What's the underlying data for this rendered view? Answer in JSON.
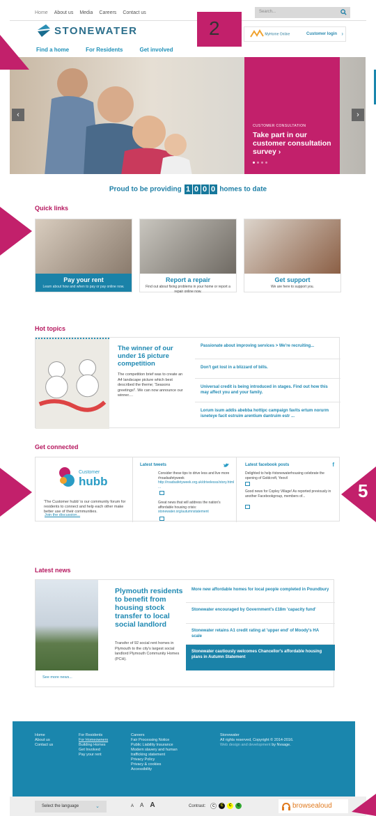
{
  "topnav": [
    "Home",
    "About us",
    "Media",
    "Careers",
    "Contact us"
  ],
  "search_placeholder": "Search...",
  "logo_text": "STONEWATER",
  "myhome_label": "MyHome Online",
  "customer_login": "Customer login",
  "mainnav": [
    "Find a home",
    "For Residents",
    "Get involved"
  ],
  "hero": {
    "kicker": "CUSTOMER CONSULTATION",
    "title": "Take part in our customer consultation survey  ›"
  },
  "proud": {
    "before": "Proud to be providing",
    "digits": [
      "1",
      "0",
      "0",
      "0"
    ],
    "after": "homes to date"
  },
  "quick_links": {
    "heading": "Quick links",
    "items": [
      {
        "title": "Pay your rent",
        "sub": "Learn about how and when to pay or pay online now."
      },
      {
        "title": "Report a repair",
        "sub": "Find out about fixing problems in your home or report a repair online now."
      },
      {
        "title": "Get support",
        "sub": "We are here to support you."
      }
    ]
  },
  "hot_topics": {
    "heading": "Hot topics",
    "feature_title": "The winner of our under 16 picture competition",
    "feature_body": "The competition brief was to create an A4 landscape picture which best described the theme; 'Seasons greetings!'. We can now announce our winner....",
    "items": [
      "Passionate about improving services > We're recruiting...",
      "Don't get lost in a blizzard of bills.",
      "Universal credit is being introduced in stages. Find out how this may affect you and your family.",
      "Lorum isum addis abebba hottipc campaign favits ertum norurm isneteye facit estruim arentium dantruim estr ..."
    ]
  },
  "get_connected": {
    "heading": "Get connected",
    "hubb_small": "Customer",
    "hubb_big": "hubb",
    "hubb_desc": "'The Customer hubb' is our community forum for residents to connect and help each other make better use of their communities.",
    "hubb_link": "Join the discussion...",
    "tweets_heading": "Latest tweets",
    "tweet1": "Consider these tips to drive less and live more #roadsafetyweek",
    "tweet1_link": "http://roadsafetyweek.org.uk/drivelesss/story.html ...",
    "tweet2": "Great news that will address the nation's affordable housing crisis:",
    "tweet2_link": "stonewater.org/autumnstatement",
    "fb_heading": "Latest facebook posts",
    "fb1": "Delighted to help #stonewaterhousing celebrate the opening of Goldcroft, Yeovil",
    "fb2": "Good news for Copley Village! As reported previously in another Facebookgroup, members of..."
  },
  "latest_news": {
    "heading": "Latest news",
    "feature_title": "Plymouth residents to benefit from housing stock transfer to local social landlord",
    "feature_body": "Transfer of 92 social rent homes in Plymouth to the city's largest social landlord Plymouth Community Homes (PCH).",
    "items": [
      "More new affordable homes for local people completed in Poundbury",
      "Stonewater encouraged by Government's £18m 'capacity fund'",
      "Stonewater retains A1 credit rating at 'upper end' of Moody's HA scale",
      "Stonewater cautiously welcomes Chancellor's affordable housing plans in Autumn Statement"
    ],
    "more": "See more news..."
  },
  "footer": {
    "col1": [
      "Home",
      "About us",
      "Contact us"
    ],
    "col2": [
      "For Residents",
      "For Homeowners",
      "Building Homes",
      "Get Involved",
      "Pay your rent"
    ],
    "col3": [
      "Careers",
      "Fair Processing Notice",
      "Public Liability Insurance",
      "Modern slavery and human",
      "trafficking statement",
      "Privacy Policy",
      "Privacy & cookies",
      "Accessibility"
    ],
    "company": "Stonewater",
    "rights": "All rights reserved, Copyright © 2014-2016.",
    "credit_pre": "Web design and development",
    "credit_by": "by Nvsage."
  },
  "bottombar": {
    "language": "Select the language",
    "text_sizes": [
      "A",
      "A",
      "A"
    ],
    "contrast_label": "Contrast:",
    "contrast_opts": [
      "C",
      "C",
      "C",
      "C"
    ],
    "browsealoud": "browsealoud"
  },
  "annotations": [
    "2",
    "5"
  ],
  "colors": {
    "brand_blue": "#1a86ad",
    "brand_magenta": "#c2206b"
  }
}
